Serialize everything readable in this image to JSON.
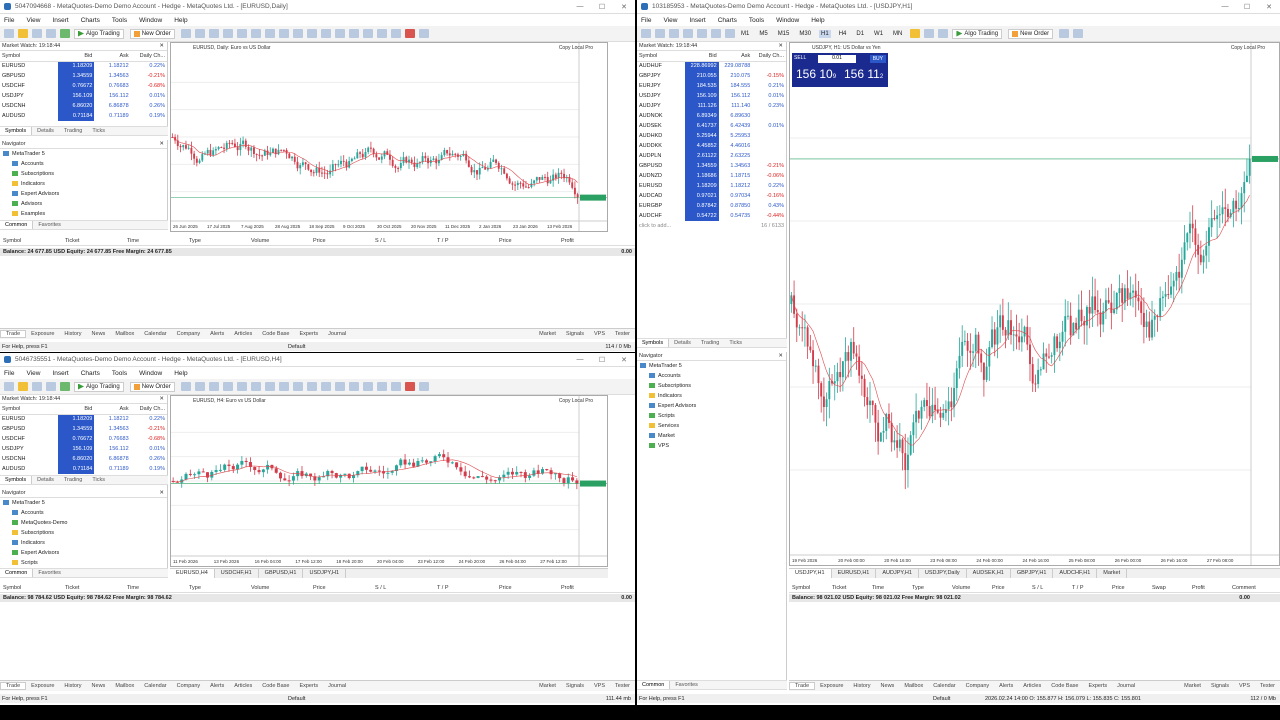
{
  "w1": {
    "title": "5047094668 - MetaQuotes-Demo Demo Account - Hedge - MetaQuotes Ltd. - [EURUSD,Daily]",
    "chart_label": "EURUSD, Daily: Euro vs US Dollar",
    "axis_dates": [
      "26 Jun 2025",
      "17 Jul 2025",
      "7 Aug 2025",
      "28 Aug 2025",
      "18 Sep 2025",
      "9 Oct 2025",
      "30 Oct 2025",
      "20 Nov 2025",
      "11 Dec 2025",
      "2 Jan 2026",
      "23 Jan 2026",
      "13 Feb 2026"
    ],
    "mw_title": "Market Watch: 19:18:44",
    "mw_rows": [
      [
        "EURUSD",
        "1.18209",
        "1.18212",
        "0.22%"
      ],
      [
        "GBPUSD",
        "1.34559",
        "1.34563",
        "-0.21%"
      ],
      [
        "USDCHF",
        "0.76672",
        "0.76683",
        "-0.68%"
      ],
      [
        "USDJPY",
        "156.109",
        "156.112",
        "0.01%"
      ],
      [
        "USDCNH",
        "6.86020",
        "6.86878",
        "0.26%"
      ],
      [
        "AUDUSD",
        "0.71184",
        "0.71189",
        "0.19%"
      ]
    ],
    "nav": [
      "MetaTrader 5",
      "Accounts",
      "Subscriptions",
      "Indicators",
      "Expert Advisors",
      "Advisors",
      "Examples"
    ],
    "balance": "Balance: 24 677.85 USD  Equity: 24 677.85  Free Margin: 24 677.85",
    "profit": "0.00",
    "status": "For Help, press F1",
    "status_mid": "Default",
    "status_right": "114 / 0 Mb"
  },
  "w2": {
    "title": "5046735551 - MetaQuotes-Demo Demo Account - Hedge - MetaQuotes Ltd. - [EURUSD,H4]",
    "chart_label": "EURUSD, H4: Euro vs US Dollar",
    "axis_dates": [
      "11 Feb 2026",
      "13 Feb 2026",
      "16 Feb 04:00",
      "17 Feb 12:00",
      "18 Feb 20:00",
      "20 Feb 04:00",
      "23 Feb 12:00",
      "24 Feb 20:00",
      "26 Feb 04:00",
      "27 Feb 12:00"
    ],
    "mw_title": "Market Watch: 19:18:44",
    "mw_rows": [
      [
        "EURUSD",
        "1.18209",
        "1.18212",
        "0.22%"
      ],
      [
        "GBPUSD",
        "1.34559",
        "1.34563",
        "-0.21%"
      ],
      [
        "USDCHF",
        "0.76672",
        "0.76683",
        "-0.68%"
      ],
      [
        "USDJPY",
        "156.109",
        "156.112",
        "0.01%"
      ],
      [
        "USDCNH",
        "6.86020",
        "6.86878",
        "0.26%"
      ],
      [
        "AUDUSD",
        "0.71184",
        "0.71189",
        "0.19%"
      ]
    ],
    "nav": [
      "MetaTrader 5",
      "Accounts",
      "MetaQuotes-Demo",
      "Subscriptions",
      "Indicators",
      "Expert Advisors",
      "Scripts"
    ],
    "chart_tabs": [
      "EURUSD,H4",
      "USDCHF,H1",
      "GBPUSD,H1",
      "USDJPY,H1"
    ],
    "balance": "Balance: 98 784.62 USD  Equity: 98 784.62  Free Margin: 98 784.62",
    "profit": "0.00",
    "status": "For Help, press F1",
    "status_mid": "Default",
    "status_right": "111.44 mb"
  },
  "w3": {
    "title": "103185953 - MetaQuotes-Demo Demo Account - Hedge - MetaQuotes Ltd. - [USDJPY,H1]",
    "chart_label": "USDJPY, H1: US Dollar vs Yen",
    "axis_dates": [
      "19 Feb 2026",
      "20 Feb 00:00",
      "20 Feb 16:00",
      "23 Feb 08:00",
      "24 Feb 00:00",
      "24 Feb 16:00",
      "25 Feb 08:00",
      "26 Feb 00:00",
      "26 Feb 16:00",
      "27 Feb 08:00"
    ],
    "mw_title": "Market Watch: 19:18:44",
    "mw_rows": [
      [
        "AUDHUF",
        "228.86992",
        "229.08788",
        ""
      ],
      [
        "GBPJPY",
        "210.055",
        "210.075",
        "-0.15%"
      ],
      [
        "EURJPY",
        "184.535",
        "184.555",
        "0.21%"
      ],
      [
        "USDJPY",
        "156.109",
        "156.112",
        "0.01%"
      ],
      [
        "AUDJPY",
        "111.126",
        "111.140",
        "0.23%"
      ],
      [
        "AUDNOK",
        "6.89349",
        "6.89630",
        ""
      ],
      [
        "AUDSEK",
        "6.41737",
        "6.42439",
        "0.01%"
      ],
      [
        "AUDHKD",
        "5.25944",
        "5.25953",
        ""
      ],
      [
        "AUDDKK",
        "4.45852",
        "4.46016",
        ""
      ],
      [
        "AUDPLN",
        "2.61122",
        "2.63225",
        ""
      ],
      [
        "GBPUSD",
        "1.34559",
        "1.34563",
        "-0.21%"
      ],
      [
        "AUDNZD",
        "1.18686",
        "1.18715",
        "-0.06%"
      ],
      [
        "EURUSD",
        "1.18209",
        "1.18212",
        "0.22%"
      ],
      [
        "AUDCAD",
        "0.97021",
        "0.97034",
        "-0.16%"
      ],
      [
        "EURGBP",
        "0.87842",
        "0.87850",
        "0.43%"
      ],
      [
        "AUDCHF",
        "0.54722",
        "0.54735",
        "-0.44%"
      ]
    ],
    "click_add": "click to add...",
    "count": "16 / 6133",
    "nav": [
      "MetaTrader 5",
      "Accounts",
      "Subscriptions",
      "Indicators",
      "Expert Advisors",
      "Scripts",
      "Services",
      "Market",
      "VPS"
    ],
    "chart_tabs": [
      "USDJPY,H1",
      "EURUSD,H1",
      "AUDJPY,H1",
      "USDJPY,Daily",
      "AUDSEK,H1",
      "GBPJPY,H1",
      "AUDCHF,H1",
      "Market"
    ],
    "sell": "SELL",
    "buy": "BUY",
    "lot": "0.01",
    "sell_big": "156 10",
    "sell_sup": "9",
    "buy_big": "156 11",
    "buy_sup": "2",
    "balance": "Balance: 98 021.02 USD  Equity: 98 021.02  Free Margin: 98 021.02",
    "profit": "0.00",
    "status": "For Help, press F1",
    "status_mid": "Default",
    "status_right": "112 / 0 Mb",
    "status_date": "2026.02.24 14:00  O: 155.877  H: 156.079  L: 155.835  C: 155.801"
  },
  "common": {
    "menu": [
      "File",
      "View",
      "Insert",
      "Charts",
      "Tools",
      "Window",
      "Help"
    ],
    "algo": "Algo Trading",
    "new_order": "New Order",
    "symbol": "Symbol",
    "bid": "Bid",
    "ask": "Ask",
    "daily": "Daily Ch...",
    "tabs_mw": [
      "Symbols",
      "Details",
      "Trading",
      "Ticks"
    ],
    "nav_title": "Navigator",
    "nav_tabs": [
      "Common",
      "Favorites"
    ],
    "trade_cols": [
      "Symbol",
      "Ticket",
      "Time",
      "Type",
      "Volume",
      "Price",
      "S / L",
      "T / P",
      "Price",
      "Profit"
    ],
    "trade_cols3": [
      "Symbol",
      "Ticket",
      "Time",
      "Type",
      "Volume",
      "Price",
      "S / L",
      "T / P",
      "Price",
      "Swap",
      "Profit",
      "Comment"
    ],
    "bottom_tabs": [
      "Trade",
      "Exposure",
      "History",
      "News",
      "Mailbox",
      "Calendar",
      "Company",
      "Alerts",
      "Articles",
      "Code Base",
      "Experts",
      "Journal"
    ],
    "bottom_right": [
      "Market",
      "Signals",
      "VPS",
      "Tester"
    ],
    "copy": "Copy Local Pro",
    "timeframes": [
      "M1",
      "M5",
      "M15",
      "M30",
      "H1",
      "H4",
      "D1",
      "W1",
      "MN"
    ]
  }
}
